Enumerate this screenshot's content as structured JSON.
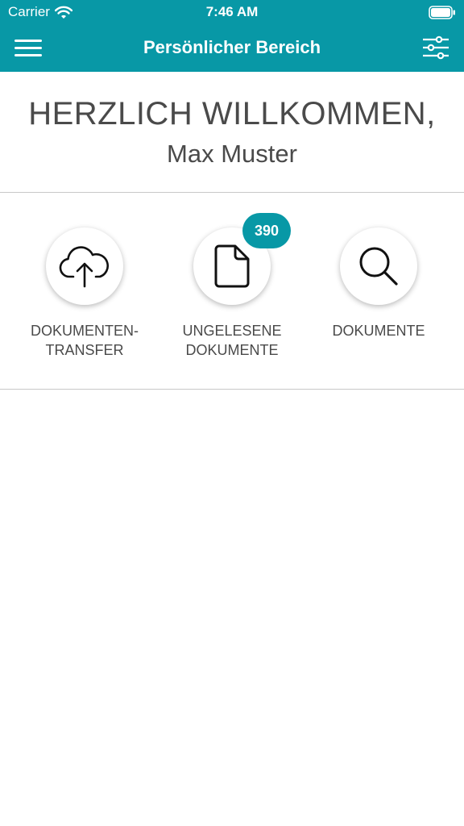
{
  "status_bar": {
    "carrier": "Carrier",
    "time": "7:46 AM"
  },
  "nav": {
    "title": "Persönlicher Bereich",
    "menu_icon": "hamburger-menu-icon",
    "filter_icon": "sliders-icon"
  },
  "welcome": {
    "title": "HERZLICH WILLKOMMEN,",
    "name": "Max Muster"
  },
  "actions": [
    {
      "line1": "DOKUMENTEN-",
      "line2": "TRANSFER",
      "icon": "cloud-upload-icon"
    },
    {
      "line1": "UNGELESENE",
      "line2": "DOKUMENTE",
      "icon": "document-icon",
      "badge": "390"
    },
    {
      "line1": "DOKUMENTE",
      "line2": "",
      "icon": "search-icon"
    }
  ],
  "colors": {
    "accent": "#0898a6",
    "text": "#4a4a4a",
    "divider": "#c8c8c8"
  }
}
